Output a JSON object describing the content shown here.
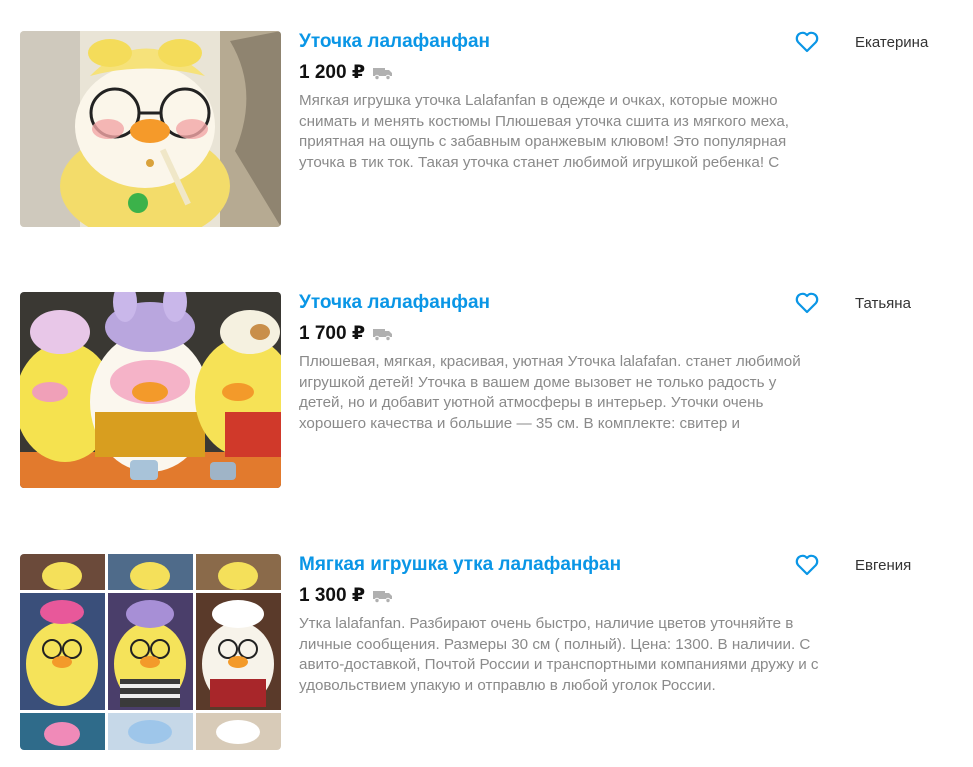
{
  "listings": [
    {
      "title": "Уточка лалафанфан",
      "price": "1 200 ₽",
      "description": "Мягкая игрушка уточка Lalafanfan в одежде и очках, которые можно снимать и менять костюмы Плюшевая уточка сшита из мягкого меха, приятная на ощупь с забавным оранжевым клювом! Это популярная уточка в тик ток. Такая уточка станет любимой игрушкой ребенка! С",
      "seller": "Екатерина",
      "image_icon": "duck-toy-photo"
    },
    {
      "title": "Уточка лалафанфан",
      "price": "1 700 ₽",
      "description": "Плюшевая, мягкая, красивая, уютная Уточка lalafafan. станет любимой игрушкой детей! Уточка в вашем доме вызовет не только радость у детей, но и добавит уютной атмосферы в интерьер. Уточки очень хорошего качества и большие — 35 см. В комплекте: свитер и",
      "seller": "Татьяна",
      "image_icon": "three-duck-toys-photo"
    },
    {
      "title": "Мягкая игрушка утка лалафанфан",
      "price": "1 300 ₽",
      "description": "Утка lalafanfan. Разбирают очень быстро, наличие цветов уточняйте в личные сообщения. Размеры 30 см ( полный). Цена: 1300. В наличии. С авито-доставкой, Почтой России и транспортными компаниями дружу и с удовольствием упакую и отправлю в любой уголок России.",
      "seller": "Евгения",
      "image_icon": "duck-collage-photo"
    }
  ],
  "colors": {
    "title": "#0a96e6",
    "price": "#111111",
    "description": "#8a8a8a",
    "favorite_icon": "#0a96e6",
    "delivery_icon": "#b0b0b0"
  },
  "icons": {
    "favorite": "heart-outline-icon",
    "delivery": "truck-icon"
  }
}
